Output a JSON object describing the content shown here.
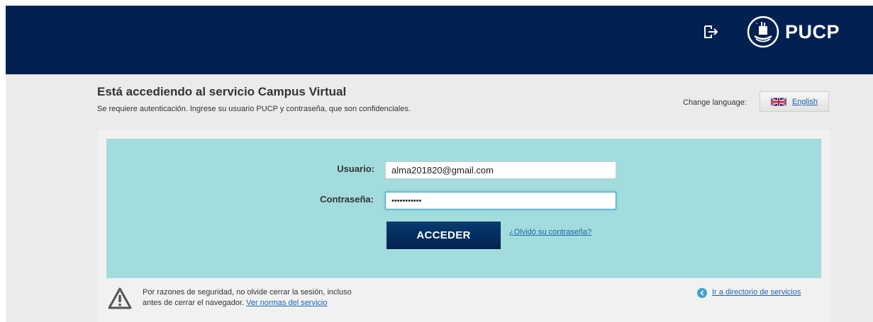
{
  "header": {
    "brand": "PUCP",
    "bg_color": "#032150",
    "logout_icon": "logout-icon"
  },
  "page": {
    "title": "Está accediendo al servicio Campus Virtual",
    "subtitle": "Se requiere autenticación. Ingrese su usuario PUCP y contraseña, que son confidenciales."
  },
  "language": {
    "label": "Change language:",
    "button_label": "English",
    "flag_icon": "uk-flag-icon"
  },
  "form": {
    "username_label": "Usuario:",
    "username_value": "alma201820@gmail.com",
    "password_label": "Contraseña:",
    "password_value": "•••••••••••",
    "submit_label": "ACCEDER",
    "forgot_label": "¿Olvidó su contraseña?",
    "box_color": "#a3dcdc"
  },
  "footer": {
    "warning_text": "Por razones de seguridad, no olvide cerrar la sesión, incluso",
    "warning_text_2": "antes de cerrar el navegador.",
    "rules_link": "Ver normas del servicio",
    "directory_link": "Ir a directorio de servicios",
    "warning_icon": "warning-icon",
    "directory_icon": "chevron-left-circle-icon"
  }
}
